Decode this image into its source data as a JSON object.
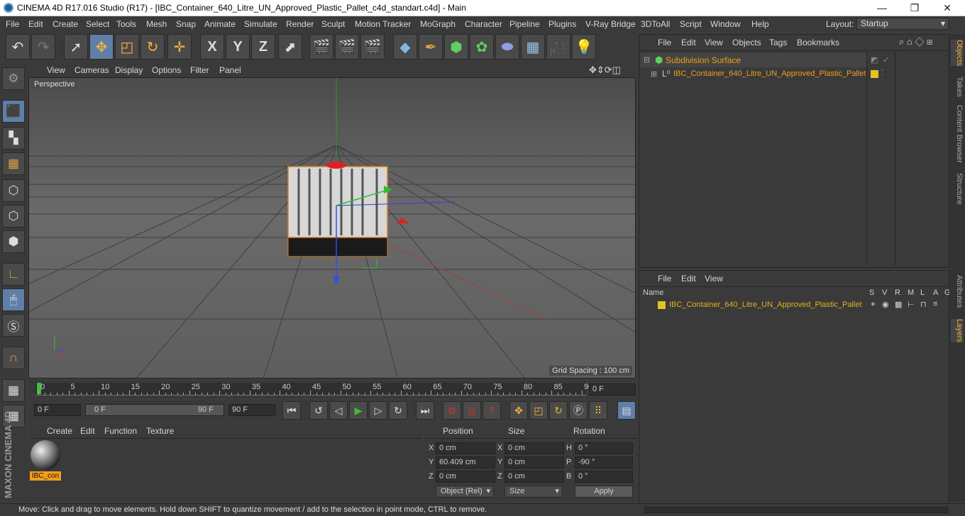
{
  "window": {
    "title": "CINEMA 4D R17.016 Studio (R17) - [IBC_Container_640_Litre_UN_Approved_Plastic_Pallet_c4d_standart.c4d] - Main",
    "minimize": "—",
    "maximize": "❐",
    "close": "✕"
  },
  "menu": {
    "items": [
      "File",
      "Edit",
      "Create",
      "Select",
      "Tools",
      "Mesh",
      "Snap",
      "Animate",
      "Simulate",
      "Render",
      "Sculpt",
      "Motion Tracker",
      "MoGraph",
      "Character",
      "Pipeline",
      "Plugins",
      "V-Ray Bridge",
      "3DToAll",
      "Script",
      "Window",
      "Help"
    ],
    "layout_label": "Layout:",
    "layout_value": "Startup"
  },
  "toolbar": {
    "axis_x": "X",
    "axis_y": "Y",
    "axis_z": "Z"
  },
  "viewport": {
    "menu": [
      "View",
      "Cameras",
      "Display",
      "Options",
      "Filter",
      "Panel"
    ],
    "label": "Perspective",
    "grid_spacing": "Grid Spacing : 100 cm"
  },
  "timeline": {
    "ticks": [
      "0",
      "5",
      "10",
      "15",
      "20",
      "25",
      "30",
      "35",
      "40",
      "45",
      "50",
      "55",
      "60",
      "65",
      "70",
      "75",
      "80",
      "85",
      "90"
    ],
    "frame_display": "0 F"
  },
  "playbar": {
    "start": "0 F",
    "range_start": "0 F",
    "range_end": "90 F",
    "end": "90 F"
  },
  "materials": {
    "menu": [
      "Create",
      "Edit",
      "Function",
      "Texture"
    ],
    "item_label": "IBC_con"
  },
  "coords": {
    "headers": {
      "position": "Position",
      "size": "Size",
      "rotation": "Rotation"
    },
    "rows": [
      {
        "axis": "X",
        "pos": "0 cm",
        "saxis": "X",
        "size": "0 cm",
        "raxis": "H",
        "rot": "0 °"
      },
      {
        "axis": "Y",
        "pos": "60.409 cm",
        "saxis": "Y",
        "size": "0 cm",
        "raxis": "P",
        "rot": "-90 °"
      },
      {
        "axis": "Z",
        "pos": "0 cm",
        "saxis": "Z",
        "size": "0 cm",
        "raxis": "B",
        "rot": "0 °"
      }
    ],
    "mode": "Object (Rel)",
    "size_mode": "Size",
    "apply": "Apply"
  },
  "objects": {
    "menu": [
      "File",
      "Edit",
      "View",
      "Objects",
      "Tags",
      "Bookmarks"
    ],
    "items": [
      {
        "name": "Subdivision Surface"
      },
      {
        "name": "IBC_Container_640_Litre_UN_Approved_Plastic_Pallet"
      }
    ]
  },
  "layers": {
    "menu": [
      "File",
      "Edit",
      "View"
    ],
    "col_name": "Name",
    "cols": [
      "S",
      "V",
      "R",
      "M",
      "L",
      "A",
      "G"
    ],
    "item": "IBC_Container_640_Litre_UN_Approved_Plastic_Pallet"
  },
  "righttabs": [
    "Objects",
    "Takes",
    "Content Browser",
    "Structure",
    "Attributes",
    "Layers"
  ],
  "status": "Move: Click and drag to move elements. Hold down SHIFT to quantize movement / add to the selection in point mode, CTRL to remove.",
  "brand": "MAXON CINEMA 4D",
  "colors": {
    "accent": "#5f7fa8",
    "highlight": "#f29e1a",
    "layer": "#e0c521"
  }
}
